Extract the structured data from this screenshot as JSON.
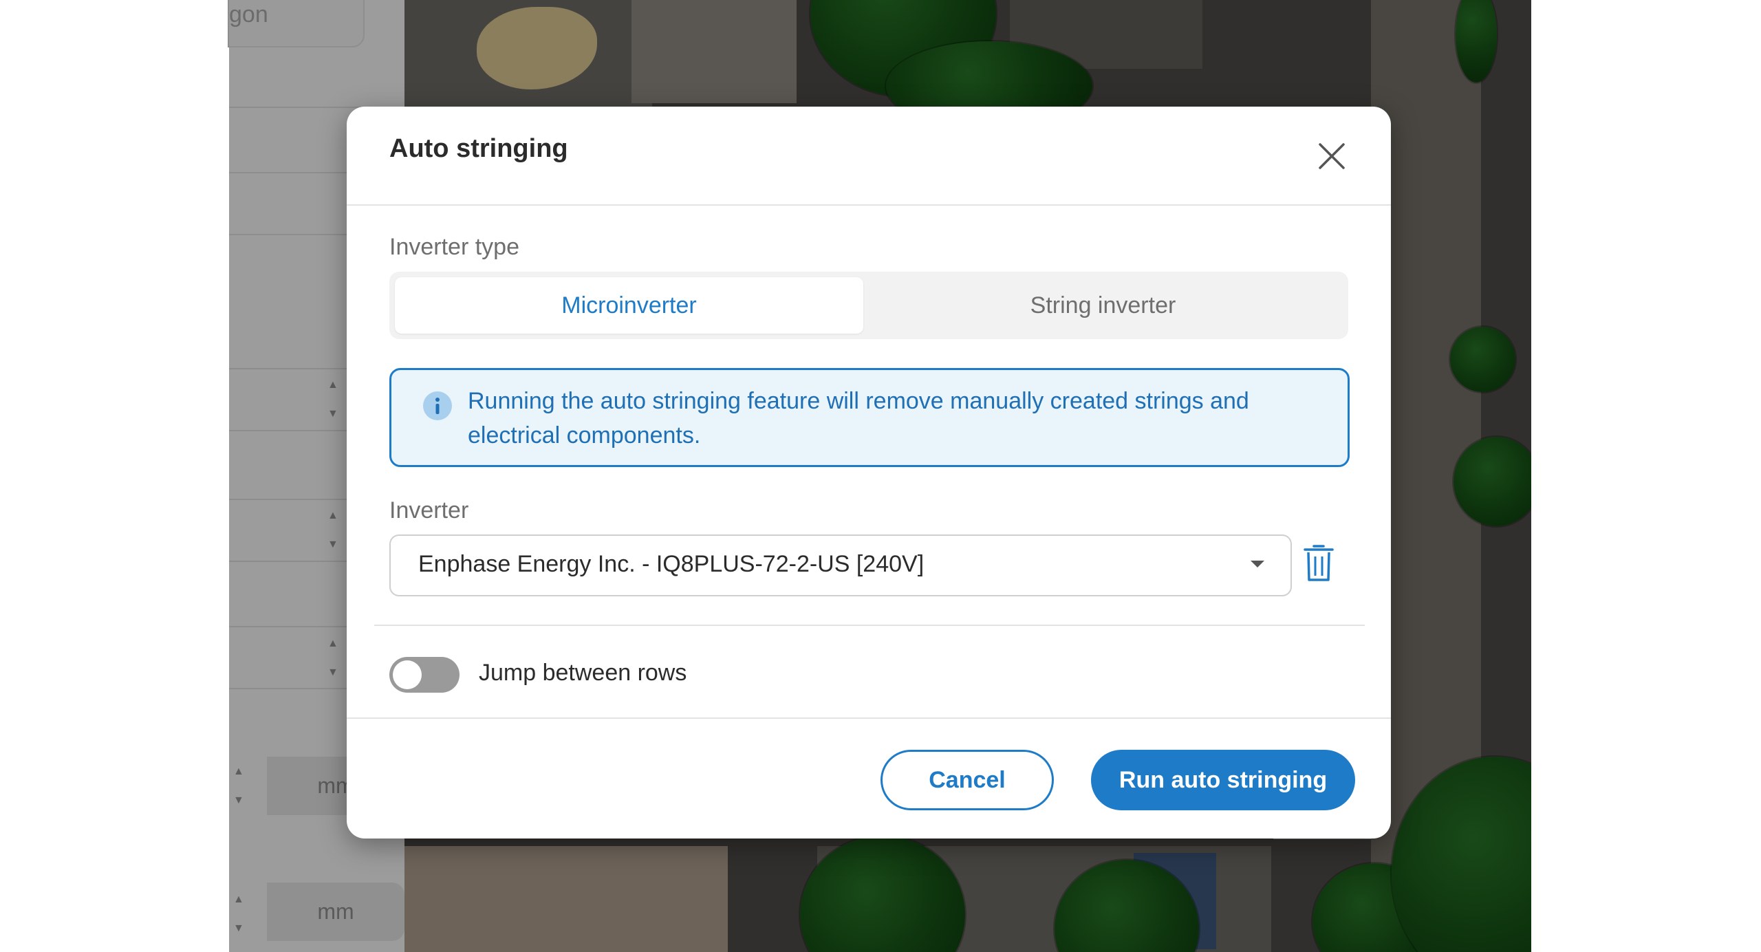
{
  "left_panel": {
    "partial_label": "gon",
    "unit_1": "mm",
    "unit_2": "mm"
  },
  "modal": {
    "title": "Auto stringing",
    "inverter_type_label": "Inverter type",
    "tabs": [
      {
        "label": "Microinverter",
        "active": true
      },
      {
        "label": "String inverter",
        "active": false
      }
    ],
    "info_message": "Running the auto stringing feature will remove manually created strings and electrical components.",
    "inverter_label": "Inverter",
    "inverter_value": "Enphase Energy Inc. - IQ8PLUS-72-2-US [240V]",
    "toggle": {
      "label": "Jump between rows",
      "checked": false
    },
    "cancel_label": "Cancel",
    "run_label": "Run auto stringing"
  },
  "colors": {
    "accent": "#1e7bc8",
    "info_background": "#eaf4fb",
    "toggle_off": "#9a9a9a"
  },
  "icons": [
    "close-icon",
    "info-icon",
    "chevron-down-icon",
    "trash-icon"
  ]
}
